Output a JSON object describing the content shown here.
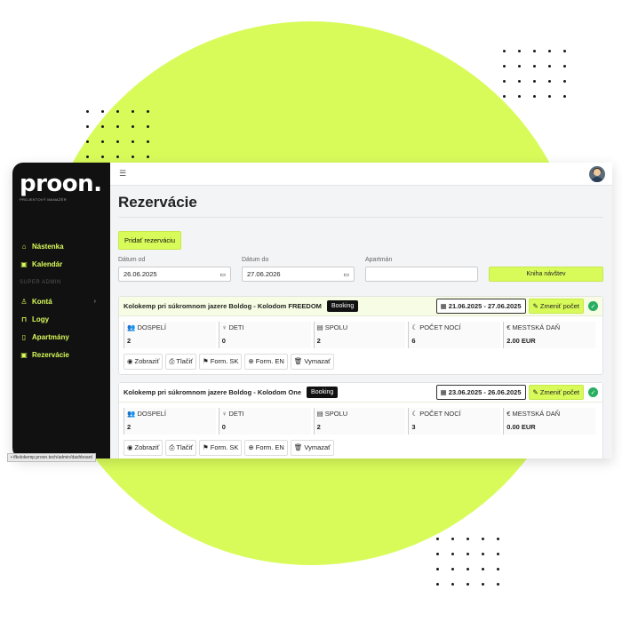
{
  "brand": {
    "logo": "proon.",
    "tagline": "PROJEKTOVÝ MANAŽÉR"
  },
  "sidebar": {
    "items": [
      {
        "label": "Nástenka",
        "icon": "home-icon"
      },
      {
        "label": "Kalendár",
        "icon": "calendar-icon"
      }
    ],
    "section": "SUPER ADMIN",
    "admin_items": [
      {
        "label": "Kontá",
        "icon": "user-icon"
      },
      {
        "label": "Logy",
        "icon": "lock-icon"
      },
      {
        "label": "Apartmány",
        "icon": "clipboard-icon"
      },
      {
        "label": "Rezervácie",
        "icon": "calendar-check-icon"
      }
    ]
  },
  "status_url": "• ifkolokemp.proon.tech/admin/dashboard",
  "page": {
    "title": "Rezervácie",
    "add_button": "Pridať rezerváciu"
  },
  "filters": {
    "date_from_label": "Dátum od",
    "date_from": "26.06.2025",
    "date_to_label": "Dátum do",
    "date_to": "27.06.2026",
    "apartment_label": "Apartmán",
    "apartment_value": "",
    "guestbook_button": "Kniha návštev"
  },
  "labels": {
    "adults": "DOSPELÍ",
    "children": "DETI",
    "total": "SPOLU",
    "nights": "POČET NOCÍ",
    "tax": "MESTSKÁ DAŇ",
    "change": "Zmeniť počet",
    "view": "Zobraziť",
    "print": "Tlačiť",
    "form_sk": "Form. SK",
    "form_en": "Form. EN",
    "delete": "Vymazať"
  },
  "reservations": [
    {
      "title": "Kolokemp pri súkromnom jazere Boldog - Kolodom FREEDOM",
      "source": "Booking",
      "date_range": "21.06.2025 - 27.06.2025",
      "adults": "2",
      "children": "0",
      "total": "2",
      "nights": "6",
      "tax": "2.00 EUR"
    },
    {
      "title": "Kolokemp pri súkromnom jazere Boldog - Kolodom One",
      "source": "Booking",
      "date_range": "23.06.2025 - 26.06.2025",
      "adults": "2",
      "children": "0",
      "total": "2",
      "nights": "3",
      "tax": "0.00 EUR"
    }
  ],
  "colors": {
    "accent": "#d9fb5a",
    "sidebar": "#111111",
    "success": "#27ae60"
  }
}
